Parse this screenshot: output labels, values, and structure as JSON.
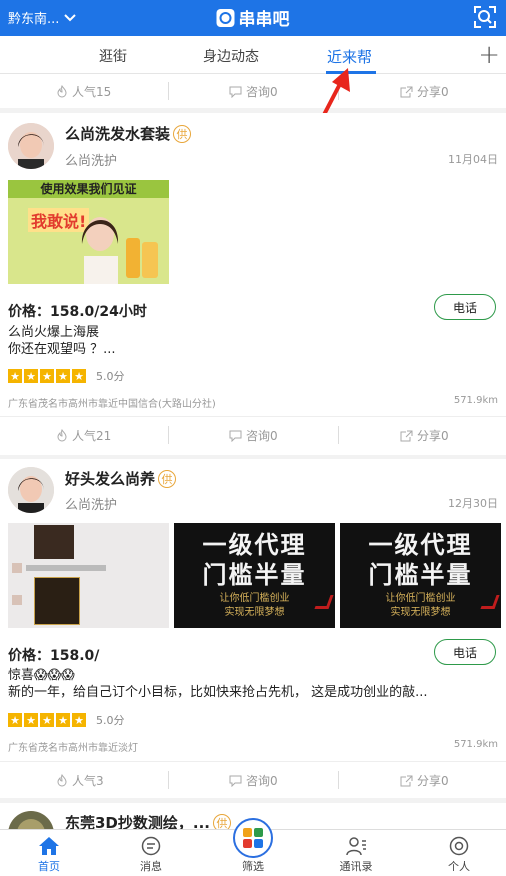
{
  "header": {
    "location": "黔东南...",
    "brand": "串串吧"
  },
  "tabs": [
    {
      "label": "逛街"
    },
    {
      "label": "身边动态"
    },
    {
      "label": "近来帮"
    }
  ],
  "top_stats": {
    "popularity": "人气15",
    "consult": "咨询0",
    "share": "分享0"
  },
  "posts": [
    {
      "title": "么尚洗发水套装",
      "tag": "供",
      "shop": "么尚洗护",
      "date": "11月04日",
      "banner": {
        "headline": "使用效果我们见证",
        "slogan": "我敢说!"
      },
      "price": "价格：158.0/24小时",
      "call": "电话",
      "desc_lines": [
        "么尚火爆上海展",
        "你还在观望吗 ？..."
      ],
      "score": "5.0分",
      "address": "广东省茂名市高州市靠近中国信合(大路山分社)",
      "distance": "571.9km",
      "stats": {
        "popularity": "人气21",
        "consult": "咨询0",
        "share": "分享0"
      }
    },
    {
      "title": "好头发么尚养",
      "tag": "供",
      "shop": "么尚洗护",
      "date": "12月30日",
      "poster_text": {
        "line1": "一级代理",
        "line2": "门槛半量",
        "line3": "让你低门槛创业",
        "line4": "实现无限梦想"
      },
      "price": "价格：158.0/",
      "call": "电话",
      "desc_lines": [
        "惊喜😱😱😱",
        "新的一年，给自己订个小目标，比如快来抢占先机， 这是成功创业的敲..."
      ],
      "score": "5.0分",
      "address": "广东省茂名市高州市靠近淡灯",
      "distance": "571.9km",
      "stats": {
        "popularity": "人气3",
        "consult": "咨询0",
        "share": "分享0"
      }
    },
    {
      "title": "东莞3D抄数测绘，...",
      "tag": "供"
    }
  ],
  "bottom_nav": [
    {
      "label": "首页"
    },
    {
      "label": "消息"
    },
    {
      "label": "筛选"
    },
    {
      "label": "通讯录"
    },
    {
      "label": "个人"
    }
  ],
  "colors": {
    "primary": "#1e74e6",
    "star": "#f5b400",
    "call_border": "#2e9a4a",
    "tag": "#e8a63a",
    "arrow": "#e8261c"
  }
}
